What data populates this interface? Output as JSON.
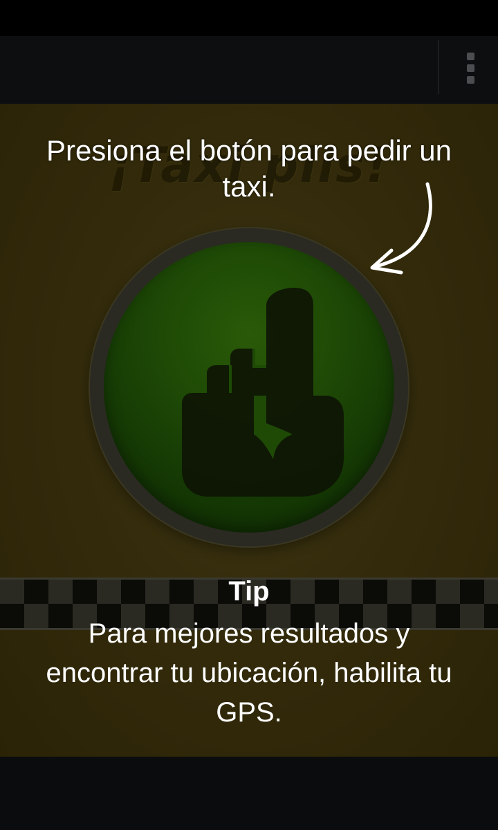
{
  "logo": {
    "text": "¡Taxi plis!"
  },
  "instruction": {
    "text": "Presiona el botón para pedir un taxi."
  },
  "tip": {
    "title": "Tip",
    "body": "Para mejores resultados y encontrar tu ubicación, habilita tu GPS."
  },
  "icons": {
    "overflow_menu": "overflow-menu-icon",
    "arrow": "curved-arrow-icon",
    "hand": "pointing-hand-icon"
  },
  "colors": {
    "background": "#332b0b",
    "button_green": "#1e4a06",
    "button_ring": "#2a2a22",
    "text": "#ffffff"
  }
}
